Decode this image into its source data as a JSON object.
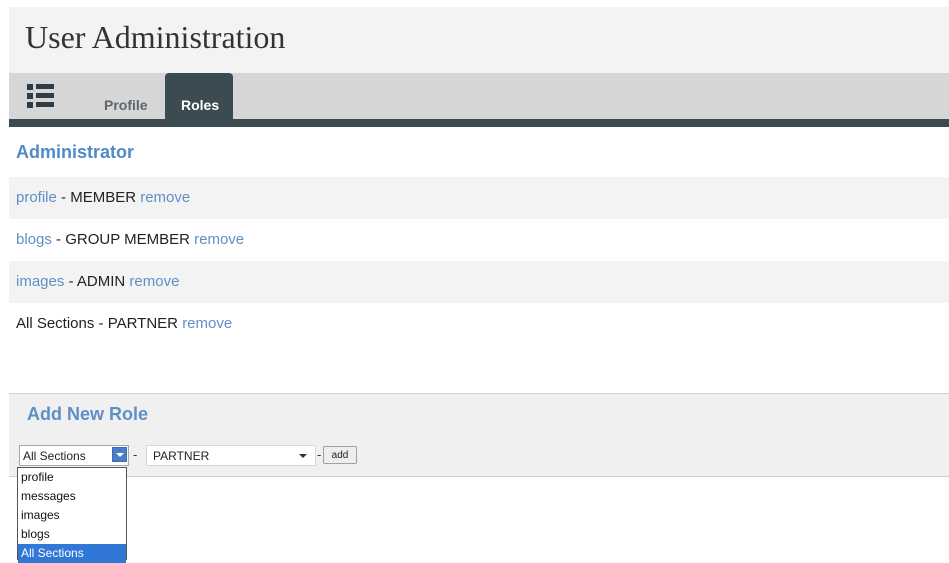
{
  "page": {
    "title": "User Administration"
  },
  "tabs": [
    {
      "label": "Profile",
      "active": false
    },
    {
      "label": "Roles",
      "active": true
    }
  ],
  "role_title": "Administrator",
  "roles": [
    {
      "section": "profile",
      "separator": " - ",
      "role": "MEMBER",
      "action": "remove",
      "section_is_link": true
    },
    {
      "section": "blogs",
      "separator": " - ",
      "role": "GROUP MEMBER",
      "action": "remove",
      "section_is_link": true
    },
    {
      "section": "images",
      "separator": " - ",
      "role": "ADMIN",
      "action": "remove",
      "section_is_link": true
    },
    {
      "section": "All Sections",
      "separator": " - ",
      "role": "PARTNER",
      "action": "remove",
      "section_is_link": false
    }
  ],
  "add_role": {
    "title": "Add New Role",
    "section_value": "All Sections",
    "dash": "-",
    "role_value": "PARTNER",
    "button_label": "add",
    "section_options": [
      "profile",
      "messages",
      "images",
      "blogs",
      "All Sections"
    ],
    "selected_option": "All Sections"
  },
  "colors": {
    "link": "#5f8fc7",
    "tab_active": "#3c4a52",
    "selected": "#3178d6"
  },
  "icons": {
    "menu": "list-menu-icon",
    "dropdown": "chevron-down-icon"
  }
}
